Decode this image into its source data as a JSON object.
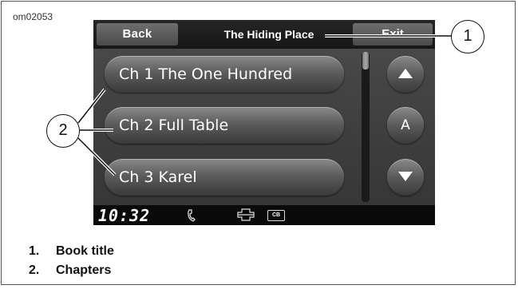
{
  "figure_id": "om02053",
  "screen": {
    "back_label": "Back",
    "title": "The Hiding Place",
    "exit_label": "Exit",
    "chapters": [
      "Ch 1 The One Hundred",
      "Ch 2 Full Table",
      "Ch 3 Karel"
    ],
    "side_buttons": {
      "up_icon": "triangle-up-icon",
      "letter_label": "A",
      "down_icon": "triangle-down-icon"
    },
    "status": {
      "clock": "10:32",
      "icons": [
        "phone-icon",
        "harley-logo-icon"
      ],
      "cb_label": "CB"
    }
  },
  "callouts": [
    {
      "number": "1"
    },
    {
      "number": "2"
    }
  ],
  "legend": [
    {
      "number": "1.",
      "label": "Book title"
    },
    {
      "number": "2.",
      "label": "Chapters"
    }
  ],
  "colors": {
    "screen_bg": "#3d3d3d",
    "topbar_bg": "#1c1c1c",
    "button_face": "#5c5c5c",
    "text": "#ffffff",
    "status_bg": "#0a0a0a"
  }
}
